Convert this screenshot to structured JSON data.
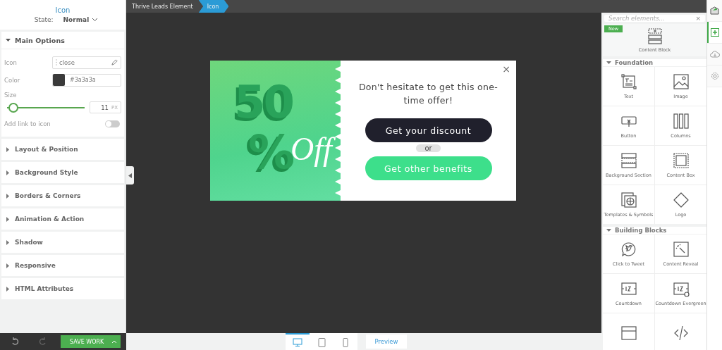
{
  "left_panel": {
    "title": "Icon",
    "state_label": "State:",
    "state_value": "Normal",
    "main_options": {
      "title": "Main Options",
      "expanded": true,
      "icon_label": "Icon",
      "icon_value": "close",
      "color_label": "Color",
      "color_value": "#3a3a3a",
      "size_label": "Size",
      "level": 0.02,
      "size_value": "11",
      "size_unit": "PX",
      "link_label": "Add link to icon",
      "link_on": false
    },
    "sections": [
      {
        "title": "Layout & Position",
        "expanded": false
      },
      {
        "title": "Background Style",
        "expanded": false
      },
      {
        "title": "Borders & Corners",
        "expanded": false
      },
      {
        "title": "Animation & Action",
        "expanded": false
      },
      {
        "title": "Shadow",
        "expanded": false
      },
      {
        "title": "Responsive",
        "expanded": false
      },
      {
        "title": "HTML Attributes",
        "expanded": false
      }
    ]
  },
  "breadcrumbs": [
    {
      "label": "Thrive Leads Element",
      "selected": false
    },
    {
      "label": "Icon",
      "selected": true
    }
  ],
  "popup": {
    "artwork": {
      "number": "50",
      "symbol": "%",
      "word": "Off"
    },
    "close": "×",
    "message": "Don't hesitate to get this one-time offer!",
    "primary_button": "Get your discount",
    "separator": "or",
    "secondary_button": "Get other benefits"
  },
  "bottom_bar": {
    "save_button": "SAVE WORK",
    "devices": [
      {
        "kind": "desktop",
        "selected": true
      },
      {
        "kind": "tablet",
        "selected": false
      },
      {
        "kind": "phone",
        "selected": false
      }
    ],
    "preview": "Preview"
  },
  "elements_panel": {
    "search_placeholder": "Search elements...",
    "clear": "×",
    "featured": {
      "badge": "New",
      "label": "Content Block",
      "kind": "content-block"
    },
    "groups": [
      {
        "title": "Foundation",
        "expanded": true,
        "items": [
          {
            "label": "Text",
            "kind": "text"
          },
          {
            "label": "Image",
            "kind": "image"
          },
          {
            "label": "Button",
            "kind": "button"
          },
          {
            "label": "Columns",
            "kind": "columns"
          },
          {
            "label": "Background Section",
            "kind": "section"
          },
          {
            "label": "Content Box",
            "kind": "box"
          },
          {
            "label": "Templates & Symbols",
            "kind": "templates"
          },
          {
            "label": "Logo",
            "kind": "logo"
          }
        ]
      },
      {
        "title": "Building Blocks",
        "expanded": true,
        "items": [
          {
            "label": "Click to Tweet",
            "kind": "tweet"
          },
          {
            "label": "Content Reveal",
            "kind": "reveal"
          },
          {
            "label": "Countdown",
            "kind": "countdown"
          },
          {
            "label": "Countdown Evergreen",
            "kind": "evergreen"
          },
          {
            "kind": "table"
          },
          {
            "kind": "code"
          }
        ]
      }
    ]
  },
  "side_toolbar": [
    {
      "kind": "mail",
      "selected": false
    },
    {
      "kind": "add",
      "selected": true
    },
    {
      "kind": "cloud",
      "selected": false
    },
    {
      "kind": "settings",
      "selected": false
    }
  ]
}
